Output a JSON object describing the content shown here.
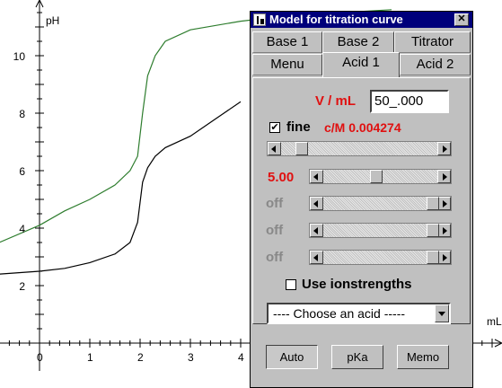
{
  "chart_data": {
    "type": "line",
    "xlabel": "mL",
    "ylabel": "pH",
    "x_ticks": [
      "0",
      "1",
      "2",
      "3",
      "4"
    ],
    "y_ticks": [
      "2",
      "4",
      "6",
      "8",
      "10"
    ],
    "xlim": [
      0,
      9
    ],
    "ylim": [
      0,
      12
    ],
    "series": [
      {
        "color": "#2e7d2e",
        "x": [
          -0.8,
          0,
          0.5,
          1.0,
          1.5,
          1.8,
          1.95,
          2.05,
          2.15,
          2.3,
          2.5,
          3.0,
          4.0,
          5.0,
          7.0
        ],
        "y": [
          3.5,
          4.1,
          4.6,
          5.0,
          5.5,
          6.0,
          6.5,
          8.0,
          9.3,
          10.0,
          10.5,
          10.9,
          11.2,
          11.4,
          11.6
        ]
      },
      {
        "color": "#000000",
        "x": [
          -0.8,
          0,
          0.5,
          1.0,
          1.5,
          1.8,
          1.95,
          2.05,
          2.15,
          2.3,
          2.5,
          3.0,
          3.5,
          4.0
        ],
        "y": [
          2.4,
          2.5,
          2.6,
          2.8,
          3.1,
          3.5,
          4.2,
          5.6,
          6.1,
          6.5,
          6.8,
          7.2,
          7.8,
          8.4
        ]
      }
    ]
  },
  "dialog": {
    "title": "Model for titration curve",
    "close_label": "✕",
    "tabs_row1": [
      "Base 1",
      "Base 2",
      "Titrator"
    ],
    "tabs_row2": [
      "Menu",
      "Acid 1",
      "Acid 2"
    ],
    "active_tab": "Acid 1",
    "volume_label": "V / mL",
    "volume_value": "50_.000",
    "fine_label": "fine",
    "fine_checked": true,
    "check_mark": "✔",
    "concentration_text": "c/M 0.004274",
    "conc_slider_position": 0.1,
    "pka_values": [
      "5.00",
      "off",
      "off",
      "off"
    ],
    "pka_slider_positions": [
      0.45,
      1.0,
      1.0,
      1.0
    ],
    "ionstrength_label": "Use ionstrengths",
    "ionstrength_checked": false,
    "acid_select": "---- Choose an acid -----",
    "buttons": [
      "Auto",
      "pKa",
      "Memo"
    ],
    "colors": {
      "titlebar": "#00007b",
      "label_red": "#e01010",
      "disabled": "#888888",
      "dialog_bg": "#c0c0c0"
    }
  }
}
